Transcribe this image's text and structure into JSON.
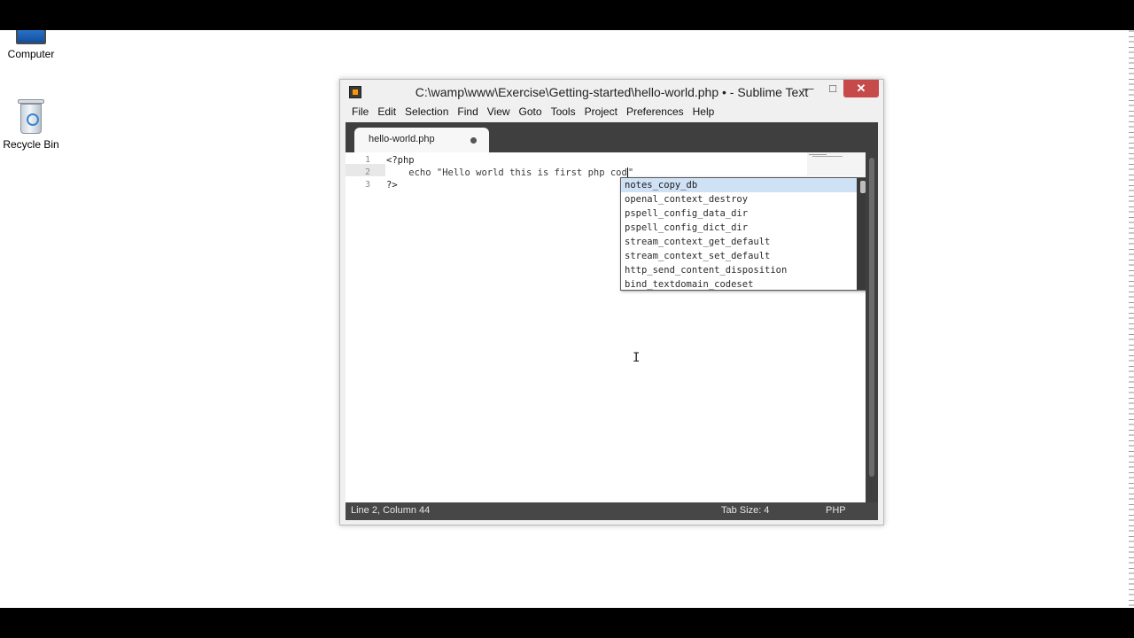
{
  "desktop": {
    "icons": [
      {
        "label": "Computer"
      },
      {
        "label": "Recycle Bin"
      }
    ]
  },
  "window": {
    "title": "C:\\wamp\\www\\Exercise\\Getting-started\\hello-world.php • - Sublime Text",
    "controls": {
      "minimize": "—",
      "maximize": "□",
      "close": "✕"
    },
    "menu": [
      "File",
      "Edit",
      "Selection",
      "Find",
      "View",
      "Goto",
      "Tools",
      "Project",
      "Preferences",
      "Help"
    ],
    "tab": {
      "label": "hello-world.php",
      "dirty": true
    },
    "editor": {
      "line_numbers": [
        "1",
        "2",
        "3"
      ],
      "lines": [
        "<?php",
        "    echo \"Hello world this is first php cod",
        "?>"
      ],
      "line2_after_caret": "\""
    },
    "autocomplete": {
      "selected_index": 0,
      "items": [
        "notes_copy_db",
        "openal_context_destroy",
        "pspell_config_data_dir",
        "pspell_config_dict_dir",
        "stream_context_get_default",
        "stream_context_set_default",
        "http_send_content_disposition",
        "bind_textdomain_codeset"
      ]
    },
    "status": {
      "position": "Line 2, Column 44",
      "tab_size": "Tab Size: 4",
      "syntax": "PHP"
    }
  },
  "colors": {
    "close_button": "#c74a4a",
    "tab_bar": "#3f3f3f",
    "status_bar": "#474747",
    "autocomplete_selected": "#cfe1f4"
  }
}
